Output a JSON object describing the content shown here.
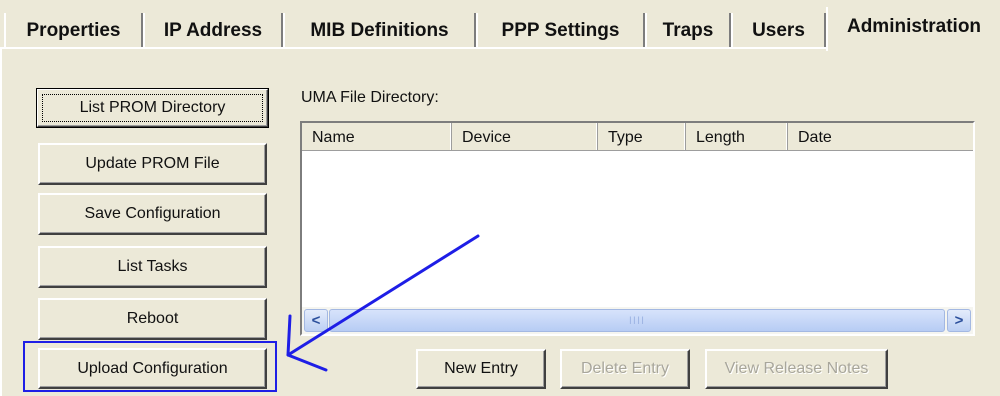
{
  "tabs": [
    {
      "label": "Properties",
      "active": false
    },
    {
      "label": "IP Address",
      "active": false
    },
    {
      "label": "MIB Definitions",
      "active": false
    },
    {
      "label": "PPP Settings",
      "active": false
    },
    {
      "label": "Traps",
      "active": false
    },
    {
      "label": "Users",
      "active": false
    },
    {
      "label": "Administration",
      "active": true
    }
  ],
  "buttons": {
    "list_prom_directory": "List PROM Directory",
    "update_prom_file": "Update PROM File",
    "save_configuration": "Save Configuration",
    "list_tasks": "List Tasks",
    "reboot": "Reboot",
    "upload_configuration": "Upload Configuration"
  },
  "file_directory": {
    "label": "UMA File Directory:",
    "columns": [
      "Name",
      "Device",
      "Type",
      "Length",
      "Date"
    ],
    "rows": []
  },
  "bottom_buttons": {
    "new_entry": "New Entry",
    "delete_entry": "Delete Entry",
    "view_release_notes": "View Release Notes"
  },
  "scrollbar": {
    "left_arrow": "<",
    "right_arrow": ">",
    "thumb_grip": "IIII"
  },
  "colors": {
    "annotation": "#1e1ee6",
    "window_bg": "#ece9d8"
  }
}
